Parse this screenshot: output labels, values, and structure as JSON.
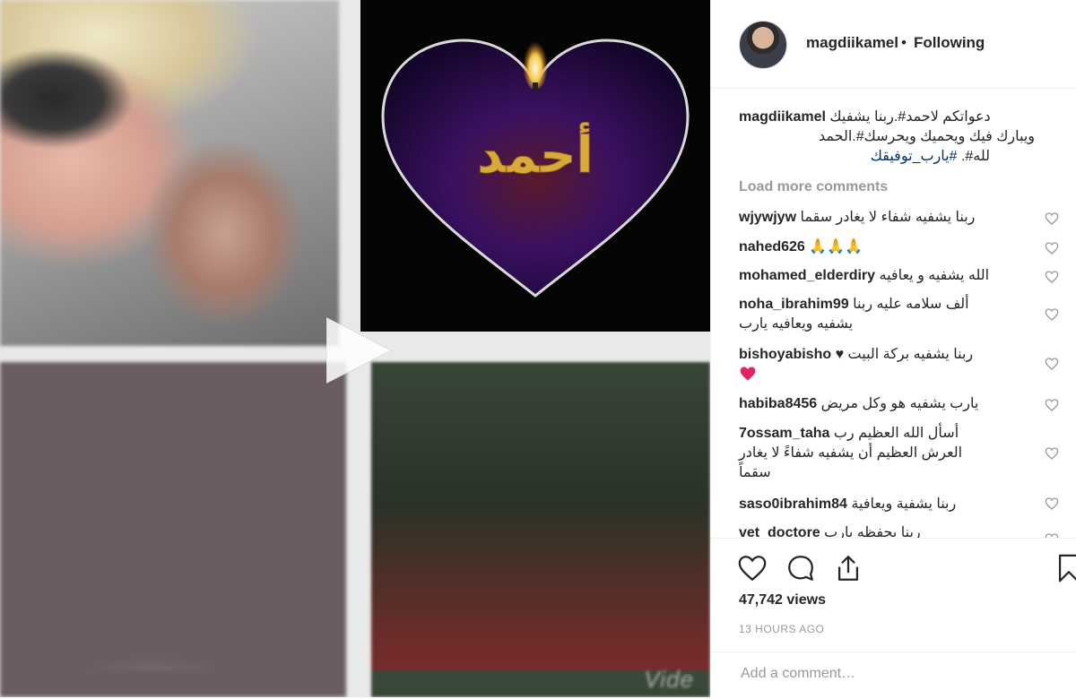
{
  "post": {
    "username": "magdiikamel",
    "separator": "•",
    "follow_status": "Following"
  },
  "video": {
    "center_text": "أحمد",
    "watermark": "Vide",
    "icons": {
      "play": "play-icon"
    }
  },
  "caption": {
    "username": "magdiikamel",
    "line1": "دعواتكم لاحمد#.ربنا يشفيك",
    "line2": "ويبارك فيك ويحميك ويحرسك#.الحمد",
    "line3_text": "لله#. ",
    "line3_tag": "#يارب_توفيقك"
  },
  "load_more": "Load more comments",
  "comments": [
    {
      "user": "wjywjyw",
      "text": "ربنا يشفيه شفاء لا يغادر سقما"
    },
    {
      "user": "nahed626",
      "text": "",
      "emoji": "🙏🙏🙏"
    },
    {
      "user": "mohamed_elderdiry",
      "text": "الله يشفيه و يعافيه"
    },
    {
      "user": "noha_ibrahim99",
      "text": "ألف سلامه عليه ربنا",
      "text2": "يشفيه ويعافيه يارب"
    },
    {
      "user": "bishoyabisho",
      "text": "♥ ربنا يشفيه بركة البيت",
      "emoji2": "red-heart"
    },
    {
      "user": "habiba8456",
      "text": "يارب يشفيه هو وكل مريض"
    },
    {
      "user": "7ossam_taha",
      "text": "أسأل الله العظيم رب",
      "text2": "العرش العظيم أن يشفيه شفاءً لا يغادر",
      "text3": "سقماً"
    },
    {
      "user": "saso0ibrahim84",
      "text": "ربنا يشفية ويعافية"
    },
    {
      "user": "vet_doctore",
      "text": "ربنا يحفظه يارب"
    }
  ],
  "stats": {
    "views": "47,742 views",
    "time_ago": "13 HOURS AGO"
  },
  "add_comment": {
    "placeholder": "Add a comment…"
  },
  "icons": {
    "like": "heart-icon",
    "comment": "comment-icon",
    "share": "share-icon",
    "save": "bookmark-icon",
    "comment_like": "small-heart-icon"
  }
}
